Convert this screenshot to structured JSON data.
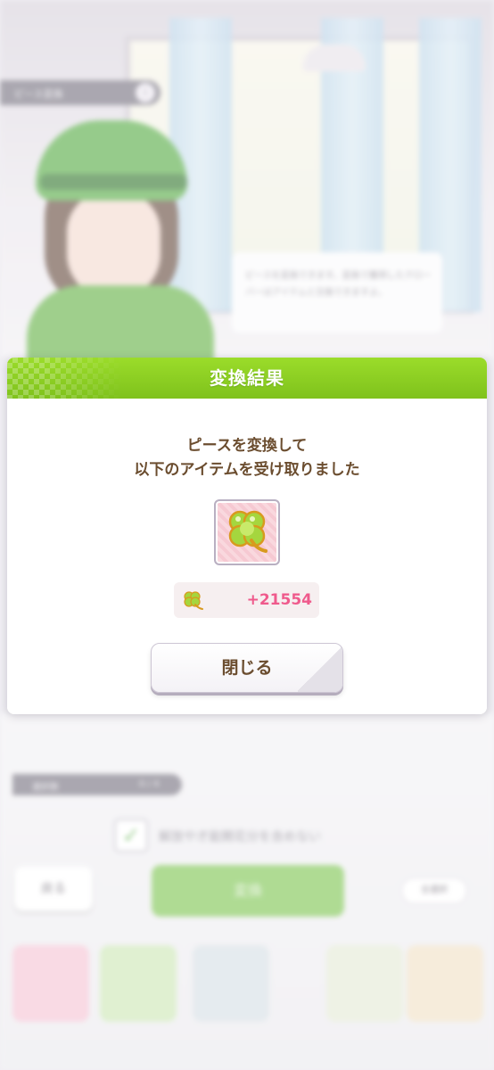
{
  "background": {
    "tag_title": "ピース変換",
    "tag_badge": "i",
    "speech_text": "ピースを変換できます。変換で獲得したクローバーはアイテムと交換できますよ。",
    "selected_label": "選択数",
    "selected_count": "0 / 4",
    "checkbox_text": "解放や才能開花分を含めない",
    "back_button": "戻る",
    "confirm_button": "変換",
    "select_all_button": "全選択"
  },
  "dialog": {
    "title": "変換結果",
    "message_line1": "ピースを変換して",
    "message_line2": "以下のアイテムを受け取りました",
    "item_icon": "clover-icon",
    "count_icon": "clover-small-icon",
    "count_value": "+21554",
    "close_button": "閉じる"
  },
  "colors": {
    "header_green": "#8cce22",
    "text_brown": "#6b4d2f",
    "count_pink": "#ef5a8c"
  }
}
